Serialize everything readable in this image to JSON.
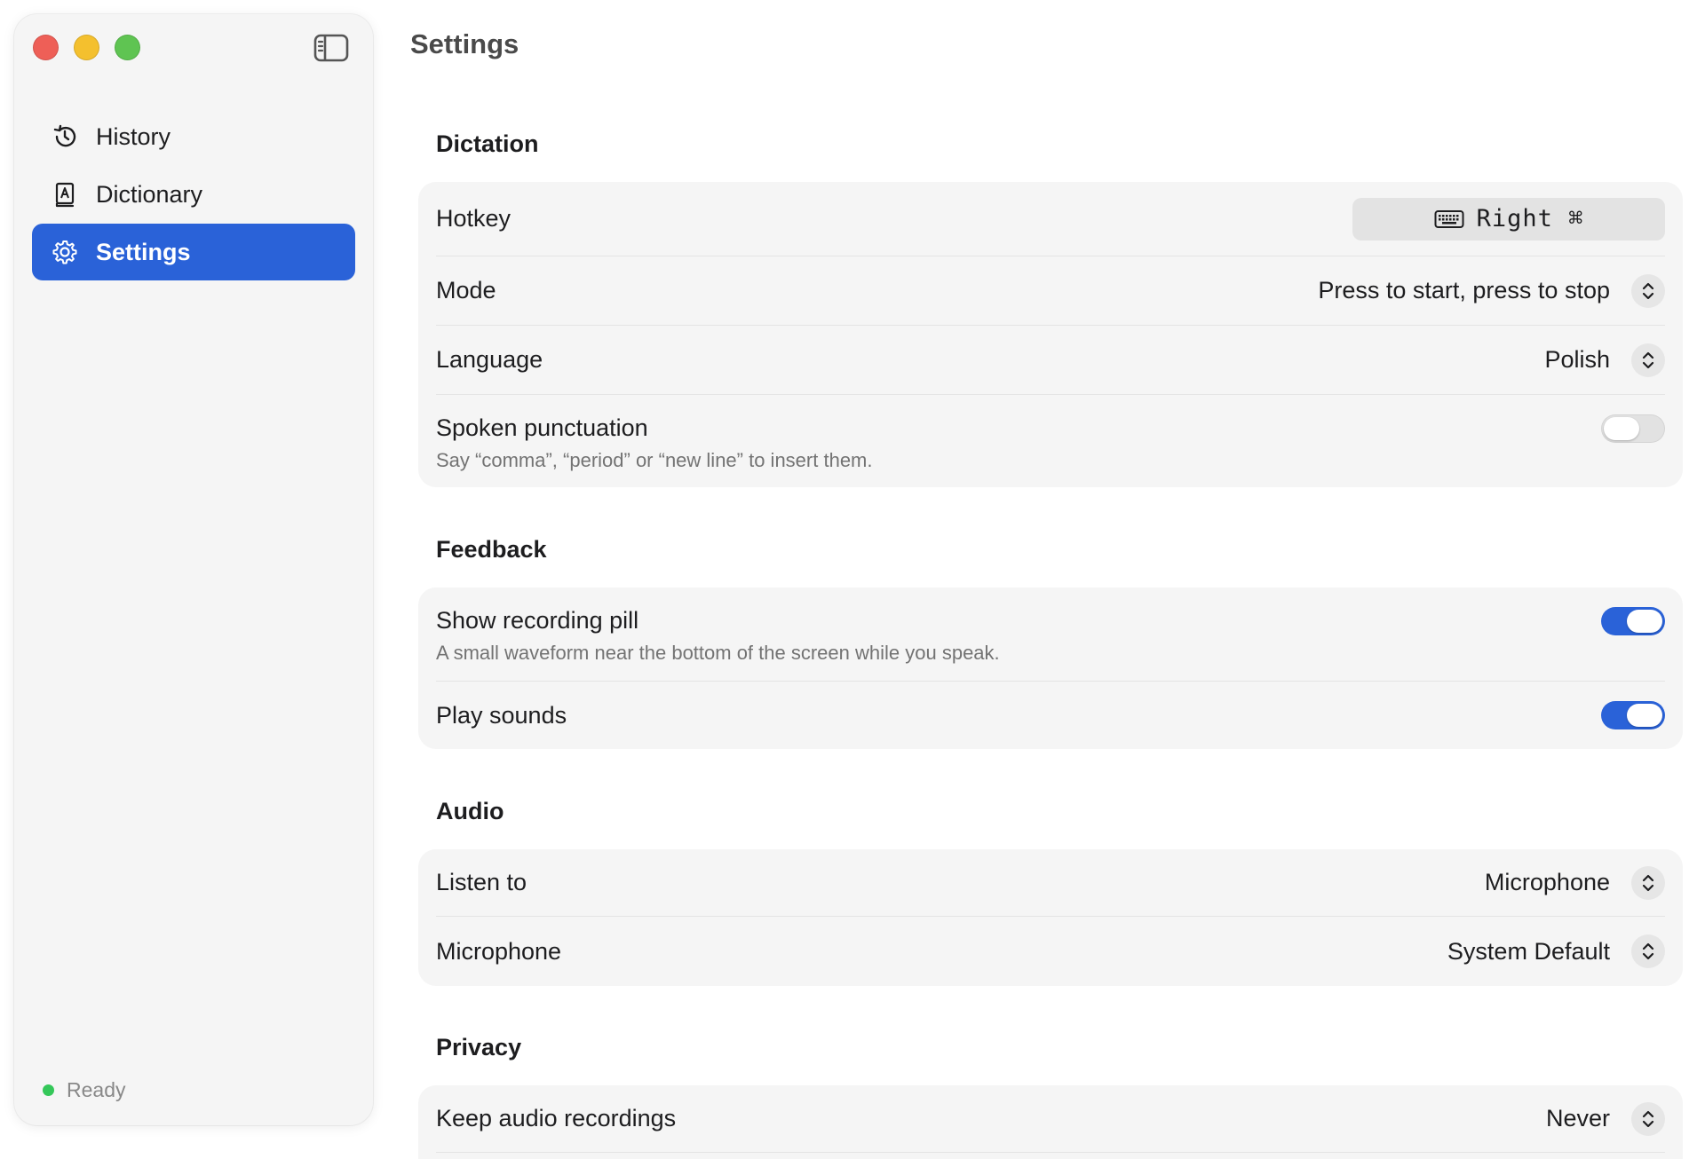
{
  "window": {
    "controls": [
      "close",
      "minimize",
      "zoom"
    ],
    "sidebar_toggle_icon": "sidebar-left-icon"
  },
  "sidebar": {
    "items": [
      {
        "label": "History",
        "icon": "clock-history-icon",
        "active": false
      },
      {
        "label": "Dictionary",
        "icon": "book-a-icon",
        "active": false
      },
      {
        "label": "Settings",
        "icon": "gear-icon",
        "active": true
      }
    ],
    "status": {
      "label": "Ready",
      "color": "#34c759"
    }
  },
  "main": {
    "title": "Settings",
    "sections": {
      "dictation": {
        "title": "Dictation",
        "hotkey": {
          "label": "Hotkey",
          "value": "Right ⌘",
          "icon": "keyboard-icon"
        },
        "mode": {
          "label": "Mode",
          "value": "Press to start, press to stop"
        },
        "language": {
          "label": "Language",
          "value": "Polish"
        },
        "spoken_punctuation": {
          "label": "Spoken punctuation",
          "description": "Say “comma”, “period” or “new line” to insert them.",
          "enabled": false
        }
      },
      "feedback": {
        "title": "Feedback",
        "recording_pill": {
          "label": "Show recording pill",
          "description": "A small waveform near the bottom of the screen while you speak.",
          "enabled": true
        },
        "play_sounds": {
          "label": "Play sounds",
          "enabled": true
        }
      },
      "audio": {
        "title": "Audio",
        "listen_to": {
          "label": "Listen to",
          "value": "Microphone"
        },
        "microphone": {
          "label": "Microphone",
          "value": "System Default"
        }
      },
      "privacy": {
        "title": "Privacy",
        "keep_recordings": {
          "label": "Keep audio recordings",
          "value": "Never"
        }
      }
    }
  },
  "colors": {
    "accent": "#2a62d8",
    "card_background": "#f5f5f5",
    "sidebar_background": "#f5f5f5",
    "traffic_red": "#ee5f57",
    "traffic_yellow": "#f4c02e",
    "traffic_green": "#5fc452"
  }
}
